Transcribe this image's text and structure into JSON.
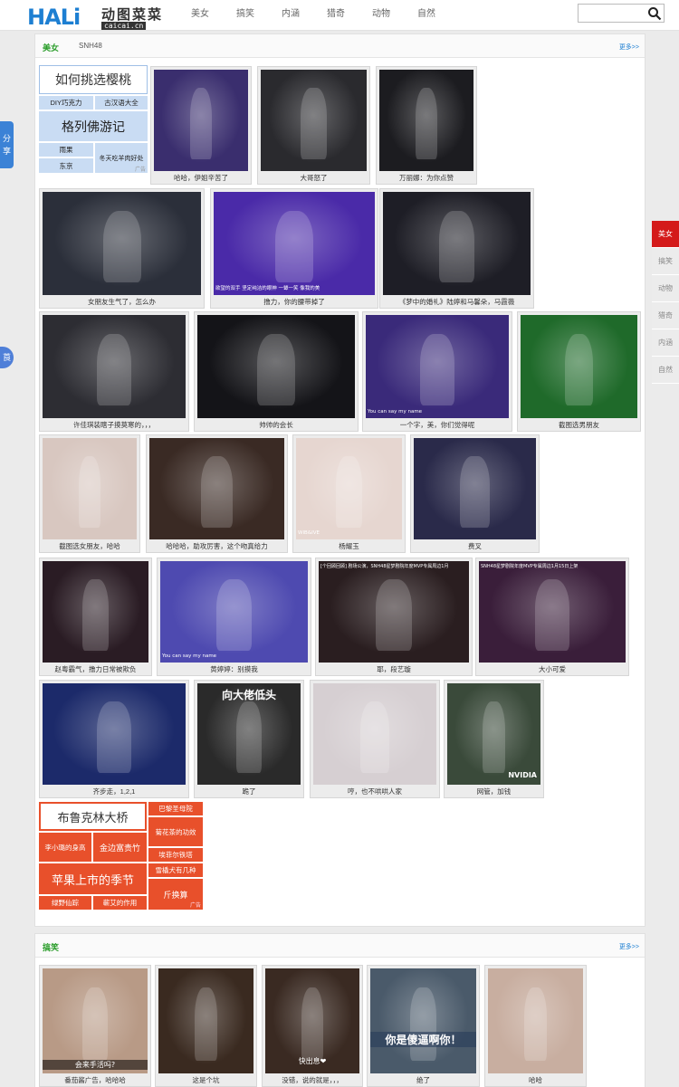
{
  "header": {
    "logo_latin": "HALi",
    "logo_cn": "动图菜菜",
    "logo_site": "caicai.cn",
    "nav": [
      "美女",
      "搞笑",
      "内涵",
      "猎奇",
      "动物",
      "自然"
    ],
    "search_placeholder": ""
  },
  "side_tabs": {
    "share": "分享",
    "bottom": "莨"
  },
  "right_nav": [
    "美女",
    "搞笑",
    "动物",
    "猎奇",
    "内涵",
    "自然"
  ],
  "section1": {
    "title": "美女",
    "subtitle": "SNH48",
    "more": "更多>>",
    "ad1": {
      "big1": "如何挑选樱桃",
      "s1": "DIY巧克力",
      "s2": "古汉语大全",
      "big2": "格列佛游记",
      "s3": "雨果",
      "s4": "东京",
      "s5": "冬天吃羊肉好处",
      "mark": "广告"
    },
    "cards": [
      {
        "caption": "哈哈，伊姐辛苦了",
        "color": "#3a2e6e"
      },
      {
        "caption": "大哥怒了",
        "color": "#2a2a2e"
      },
      {
        "caption": "万丽娜：为你点赞",
        "color": "#1c1c20"
      },
      {
        "caption": "女朋友生气了，怎么办",
        "color": "#2b2f3a"
      },
      {
        "caption": "撸力，你的腰带掉了",
        "color": "#4a2aa8"
      },
      {
        "caption": "《梦中的婚礼》陆婷和马馨朵，马霞薇",
        "color": "#1e1e26"
      },
      {
        "caption": "许佳琪装瞎子摸莫寒的，，，",
        "color": "#2d2d33"
      },
      {
        "caption": "帅帅的会长",
        "color": "#141418"
      },
      {
        "caption": "一个字，美，你们觉得呢",
        "color": "#3a2a7a"
      },
      {
        "caption": "截图选男朋友",
        "color": "#1f6a2a"
      },
      {
        "caption": "截图选女朋友，哈哈",
        "color": "#d8c7c0"
      },
      {
        "caption": "哈哈哈，助攻厉害，这个吻真给力",
        "color": "#3a2a24"
      },
      {
        "caption": "杨耀玉",
        "color": "#e6d6d0"
      },
      {
        "caption": "费叉",
        "color": "#2a2a4a"
      },
      {
        "caption": "赵粤霸气，撸力日常被欺负",
        "color": "#2a1c24"
      },
      {
        "caption": "黄婷婷：别摸我",
        "color": "#4e4ab0"
      },
      {
        "caption": "耶，段艺璇",
        "color": "#2a1e20"
      },
      {
        "caption": "大小可爱",
        "color": "#3a1e3a"
      },
      {
        "caption": "齐步走，1,2,1",
        "color": "#1c2a6a"
      },
      {
        "caption": "跪了",
        "color": "#2a2a2a"
      },
      {
        "caption": "哼，也不哄哄人家",
        "color": "#d6cfd2"
      },
      {
        "caption": "网管，加钱",
        "color": "#3a4a3a"
      }
    ],
    "overlays": {
      "c5": "欲望的双手 坚定纯洁的眼神 一颦一笑 像我的美",
      "c9": "You can say my name",
      "c13": "WIB&IVE",
      "c16": "You can say my name",
      "c17": "[个回顾回顾] 剧场公演，SNH48星梦剧院年度MVP专属周边1月",
      "c18": "SNH48星梦剧院年度MVP专属周边1月15日上架",
      "c20": "向大佬低头",
      "c22": "NVIDIA"
    },
    "ad2": {
      "big1": "布鲁克林大桥",
      "s1": "李小璐的身高",
      "s2": "金边富贵竹",
      "big2": "苹果上市的季节",
      "s3": "绿野仙踪",
      "s4": "蕲艾的作用",
      "r1": "巴黎圣母院",
      "r2": "菊花茶的功效",
      "r3": "埃菲尔铁塔",
      "r4": "雪橇犬有几种",
      "r5": "斤换算",
      "mark": "广告"
    }
  },
  "section2": {
    "title": "搞笑",
    "more": "更多>>",
    "cards": [
      {
        "caption": "番茄酱广告，哈哈哈",
        "color": "#b89a86"
      },
      {
        "caption": "这是个坑",
        "color": "#3a2a20"
      },
      {
        "caption": "没错，说的就是，，，",
        "color": "#3a2a22"
      },
      {
        "caption": "绝了",
        "color": "#4a5a6a"
      },
      {
        "caption": "哈哈",
        "color": "#c8aea0"
      }
    ],
    "overlays": {
      "g1": "会来手活吗?",
      "g3": "快出息❤",
      "g4": "你是傻逼啊你！"
    }
  }
}
